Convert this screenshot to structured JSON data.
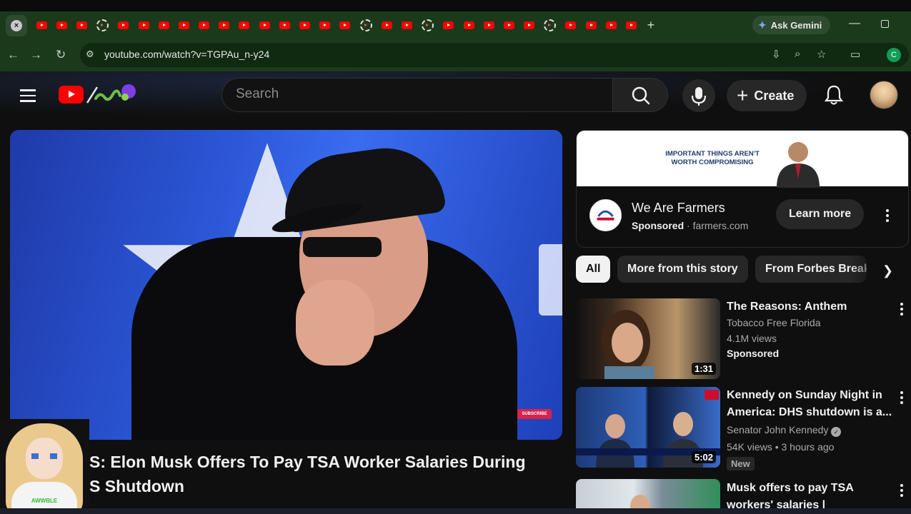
{
  "browser": {
    "ask_gemini_label": "Ask Gemini",
    "url": "youtube.com/watch?v=TGPAu_n-y24",
    "profile_initial": "C",
    "tab_count": 30
  },
  "header": {
    "search_placeholder": "Search",
    "create_label": "Create"
  },
  "video": {
    "title": "S: Elon Musk Offers To Pay TSA Worker Salaries During S Shutdown",
    "title_line1": "S: Elon Musk Offers To Pay TSA Worker Salaries During",
    "title_line2": "S Shutdown",
    "subscribe_badge": "SUBSCRIBE",
    "overlay_shirt_text": "AWWBLE"
  },
  "ad": {
    "banner_text": "IMPORTANT THINGS AREN'T WORTH COMPROMISING",
    "advertiser": "We Are Farmers",
    "sponsored_label": "Sponsored",
    "domain": "farmers.com",
    "cta": "Learn more"
  },
  "chips": [
    "All",
    "More from this story",
    "From Forbes Breaking News"
  ],
  "recommendations": [
    {
      "title": "The Reasons: Anthem",
      "channel": "Tobacco Free Florida",
      "views": "4.1M views",
      "badge": "Sponsored",
      "duration": "1:31"
    },
    {
      "title": "Kennedy on Sunday Night in America: DHS shutdown is a...",
      "channel": "Senator John Kennedy",
      "meta": "54K views • 3 hours ago",
      "badge": "New",
      "duration": "5:02",
      "verified": true
    },
    {
      "title": "Musk offers to pay TSA workers' salaries |",
      "duration": ""
    }
  ],
  "colors": {
    "browser_frame": "#1b3a1c",
    "youtube_red": "#ff0000",
    "page_bg": "#0f0f0f"
  }
}
